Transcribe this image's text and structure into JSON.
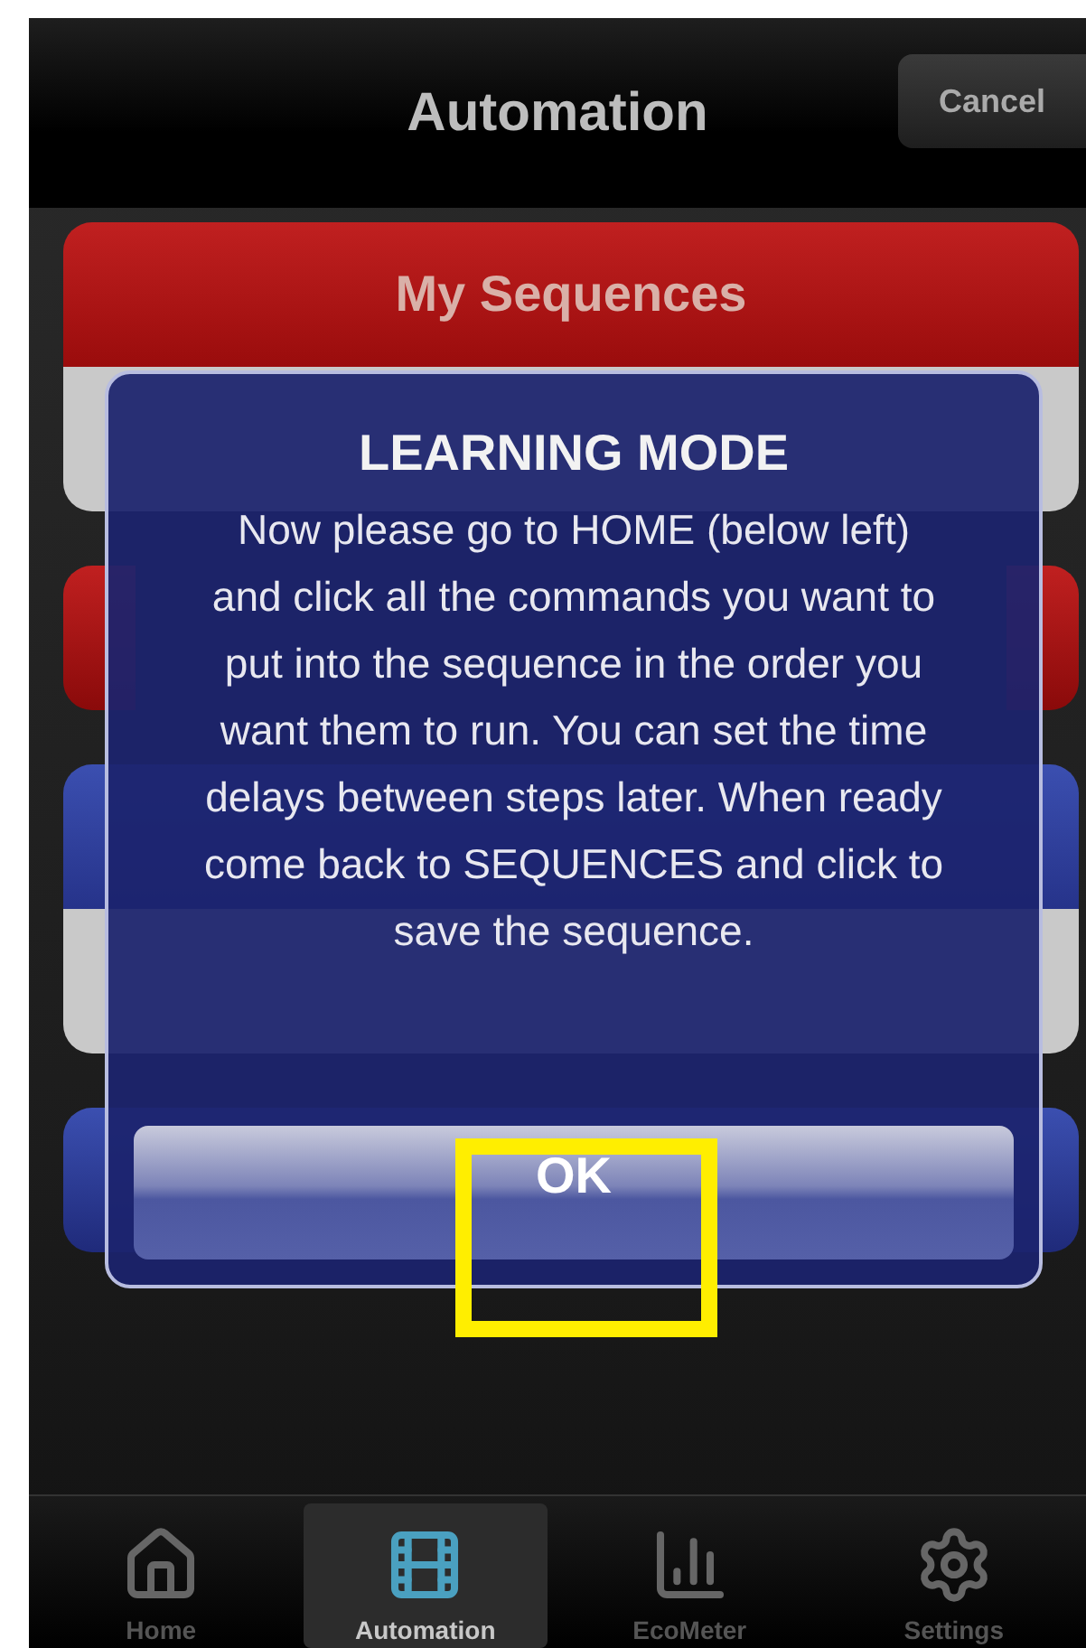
{
  "nav_bar": {
    "title": "Automation",
    "cancel_button": "Cancel"
  },
  "sections": [
    {
      "title": "My Sequences",
      "kind": "red"
    }
  ],
  "dialog": {
    "title": "LEARNING MODE",
    "message": "Now please go to HOME (below left) and click all the commands you want to put into the sequence in the order you want them to run. You can set the time delays between steps later. When ready come back to SEQUENCES and click to save the sequence.",
    "ok_button": "OK"
  },
  "tab_bar": [
    {
      "label": "Home",
      "selected": false
    },
    {
      "label": "Automation",
      "selected": true
    },
    {
      "label": "EcoMeter",
      "selected": false
    },
    {
      "label": "Settings",
      "selected": false
    }
  ]
}
